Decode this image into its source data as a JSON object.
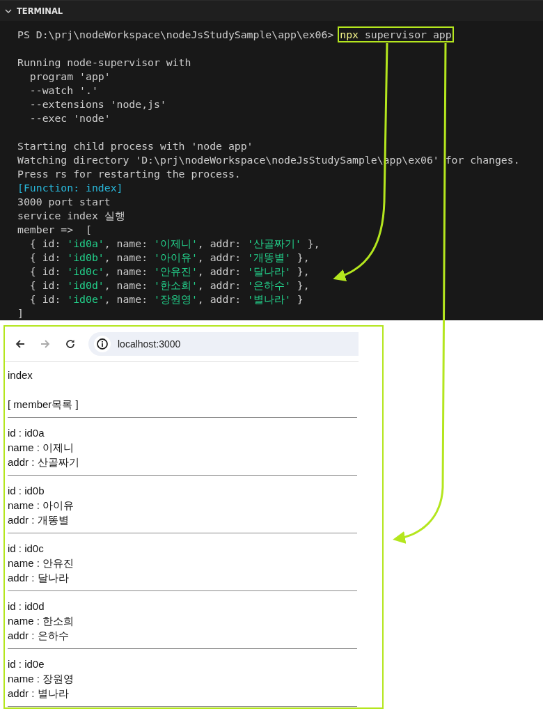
{
  "terminal": {
    "title": "TERMINAL",
    "expanded": true,
    "lines": [
      {
        "kind": "prompt",
        "prompt": "PS D:\\prj\\nodeWorkspace\\nodeJsStudySample\\app\\ex06> ",
        "highlighted": true,
        "segments": [
          {
            "kind": "command",
            "text": "npx"
          },
          {
            "kind": "plain",
            "text": " supervisor app"
          }
        ]
      },
      {
        "kind": "blank"
      },
      {
        "kind": "text",
        "segments": [
          {
            "kind": "plain",
            "text": "Running node-supervisor with"
          }
        ]
      },
      {
        "kind": "text",
        "segments": [
          {
            "kind": "plain",
            "text": "  program 'app'"
          }
        ]
      },
      {
        "kind": "text",
        "segments": [
          {
            "kind": "plain",
            "text": "  --watch '.'"
          }
        ]
      },
      {
        "kind": "text",
        "segments": [
          {
            "kind": "plain",
            "text": "  --extensions 'node,js'"
          }
        ]
      },
      {
        "kind": "text",
        "segments": [
          {
            "kind": "plain",
            "text": "  --exec 'node'"
          }
        ]
      },
      {
        "kind": "blank"
      },
      {
        "kind": "text",
        "segments": [
          {
            "kind": "plain",
            "text": "Starting child process with 'node app'"
          }
        ]
      },
      {
        "kind": "text",
        "segments": [
          {
            "kind": "plain",
            "text": "Watching directory 'D:\\prj\\nodeWorkspace\\nodeJsStudySample\\app\\ex06' for changes."
          }
        ]
      },
      {
        "kind": "text",
        "segments": [
          {
            "kind": "plain",
            "text": "Press rs for restarting the process."
          }
        ]
      },
      {
        "kind": "text",
        "segments": [
          {
            "kind": "function",
            "text": "[Function: index]"
          }
        ]
      },
      {
        "kind": "text",
        "segments": [
          {
            "kind": "plain",
            "text": "3000 port start"
          }
        ]
      },
      {
        "kind": "text",
        "segments": [
          {
            "kind": "plain",
            "text": "service index 실행"
          }
        ]
      },
      {
        "kind": "text",
        "segments": [
          {
            "kind": "plain",
            "text": "member =>  ["
          }
        ]
      },
      {
        "kind": "text",
        "segments": [
          {
            "kind": "plain",
            "text": "  { id: "
          },
          {
            "kind": "string",
            "text": "'id0a'"
          },
          {
            "kind": "plain",
            "text": ", name: "
          },
          {
            "kind": "string",
            "text": "'이제니'"
          },
          {
            "kind": "plain",
            "text": ", addr: "
          },
          {
            "kind": "string",
            "text": "'산골짜기'"
          },
          {
            "kind": "plain",
            "text": " },"
          }
        ]
      },
      {
        "kind": "text",
        "segments": [
          {
            "kind": "plain",
            "text": "  { id: "
          },
          {
            "kind": "string",
            "text": "'id0b'"
          },
          {
            "kind": "plain",
            "text": ", name: "
          },
          {
            "kind": "string",
            "text": "'아이유'"
          },
          {
            "kind": "plain",
            "text": ", addr: "
          },
          {
            "kind": "string",
            "text": "'개똥별'"
          },
          {
            "kind": "plain",
            "text": " },"
          }
        ]
      },
      {
        "kind": "text",
        "segments": [
          {
            "kind": "plain",
            "text": "  { id: "
          },
          {
            "kind": "string",
            "text": "'id0c'"
          },
          {
            "kind": "plain",
            "text": ", name: "
          },
          {
            "kind": "string",
            "text": "'안유진'"
          },
          {
            "kind": "plain",
            "text": ", addr: "
          },
          {
            "kind": "string",
            "text": "'달나라'"
          },
          {
            "kind": "plain",
            "text": " },"
          }
        ]
      },
      {
        "kind": "text",
        "segments": [
          {
            "kind": "plain",
            "text": "  { id: "
          },
          {
            "kind": "string",
            "text": "'id0d'"
          },
          {
            "kind": "plain",
            "text": ", name: "
          },
          {
            "kind": "string",
            "text": "'한소희'"
          },
          {
            "kind": "plain",
            "text": ", addr: "
          },
          {
            "kind": "string",
            "text": "'은하수'"
          },
          {
            "kind": "plain",
            "text": " },"
          }
        ]
      },
      {
        "kind": "text",
        "segments": [
          {
            "kind": "plain",
            "text": "  { id: "
          },
          {
            "kind": "string",
            "text": "'id0e'"
          },
          {
            "kind": "plain",
            "text": ", name: "
          },
          {
            "kind": "string",
            "text": "'장원영'"
          },
          {
            "kind": "plain",
            "text": ", addr: "
          },
          {
            "kind": "string",
            "text": "'별나라'"
          },
          {
            "kind": "plain",
            "text": " }"
          }
        ]
      },
      {
        "kind": "text",
        "segments": [
          {
            "kind": "plain",
            "text": "]"
          }
        ]
      }
    ]
  },
  "browser": {
    "toolbar": {
      "back_disabled": false,
      "forward_disabled": true,
      "address": "localhost:3000"
    },
    "page": {
      "heading": "index",
      "subheading": "[ member목록 ]",
      "members": [
        {
          "id": "id : id0a",
          "name": "name : 이제니",
          "addr": "addr : 산골짜기"
        },
        {
          "id": "id : id0b",
          "name": "name : 아이유",
          "addr": "addr : 개똥별"
        },
        {
          "id": "id : id0c",
          "name": "name : 안유진",
          "addr": "addr : 달나라"
        },
        {
          "id": "id : id0d",
          "name": "name : 한소희",
          "addr": "addr : 은하수"
        },
        {
          "id": "id : id0e",
          "name": "name : 장원영",
          "addr": "addr : 별나라"
        }
      ]
    }
  }
}
